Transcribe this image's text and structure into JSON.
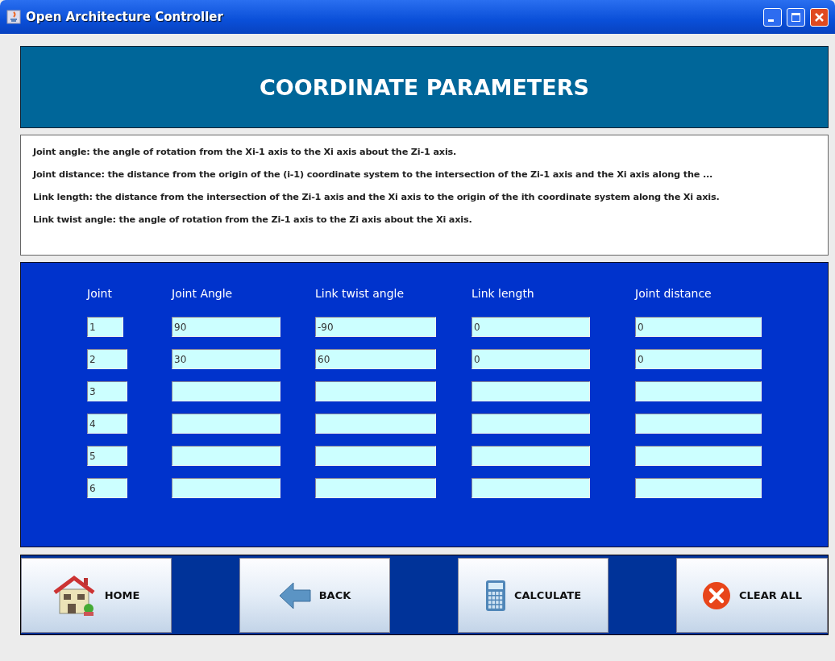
{
  "window": {
    "title": "Open Architecture Controller"
  },
  "header": {
    "title": "COORDINATE PARAMETERS"
  },
  "definitions": [
    "Joint angle: the angle of rotation from the Xi-1 axis to the Xi axis about the Zi-1 axis.",
    "Joint distance: the distance from the origin of the (i-1) coordinate system to the intersection of the Zi-1 axis and the Xi axis along the ...",
    "Link length: the distance from the intersection of the Zi-1 axis and the Xi axis to the origin of the ith coordinate system along the Xi axis.",
    "Link twist angle: the angle of rotation from the Zi-1 axis to the Zi axis about the Xi axis."
  ],
  "table": {
    "columns": [
      "Joint",
      "Joint Angle",
      "Link twist angle",
      "Link length",
      "Joint distance"
    ],
    "rows": [
      {
        "joint": "1",
        "joint_angle": "90",
        "link_twist_angle": "-90",
        "link_length": "0",
        "joint_distance": "0"
      },
      {
        "joint": "2",
        "joint_angle": "30",
        "link_twist_angle": "60",
        "link_length": "0",
        "joint_distance": "0"
      },
      {
        "joint": "3"
      },
      {
        "joint": "4"
      },
      {
        "joint": "5"
      },
      {
        "joint": "6"
      }
    ]
  },
  "buttons": [
    {
      "label": "HOME",
      "kind": "home"
    },
    {
      "label": "BACK",
      "kind": "back"
    },
    {
      "label": "CALCULATE",
      "kind": "calculate"
    },
    {
      "label": "CLEAR ALL",
      "kind": "clear"
    }
  ]
}
